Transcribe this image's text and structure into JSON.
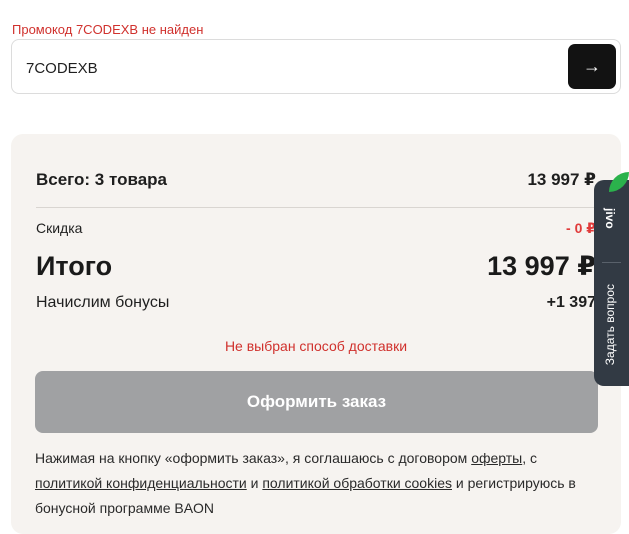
{
  "promo": {
    "error": "Промокод 7CODEXB не найден",
    "value": "7CODEXB",
    "submit_icon": "arrow-right-icon"
  },
  "summary": {
    "items_label": "Всего: 3 товара",
    "items_total": "13 997 ₽",
    "discount_label": "Скидка",
    "discount_value": "- 0 ₽",
    "total_label": "Итого",
    "total_value": "13 997 ₽",
    "bonus_label": "Начислим бонусы",
    "bonus_value": "+1 397",
    "shipping_warning": "Не выбран способ доставки",
    "checkout_label": "Оформить заказ"
  },
  "agreement": {
    "text_1": "Нажимая на кнопку «оформить заказ», я соглашаюсь с договором ",
    "link_offer": "оферты",
    "text_2": ", с ",
    "link_privacy": "политикой конфиденциальности",
    "text_3": " и ",
    "link_cookies": "политикой обработки cookies",
    "text_4": " и регистрируюсь в бонусной программе BAON"
  },
  "chat_widget": {
    "brand": "jivo",
    "label": "Задать вопрос"
  },
  "colors": {
    "error": "#d0312d",
    "discount": "#e03a3a",
    "checkout_disabled": "#a0a1a3",
    "panel_background": "#f6f3f0",
    "chat_background": "#323a44",
    "chat_accent": "#2bb24c"
  }
}
